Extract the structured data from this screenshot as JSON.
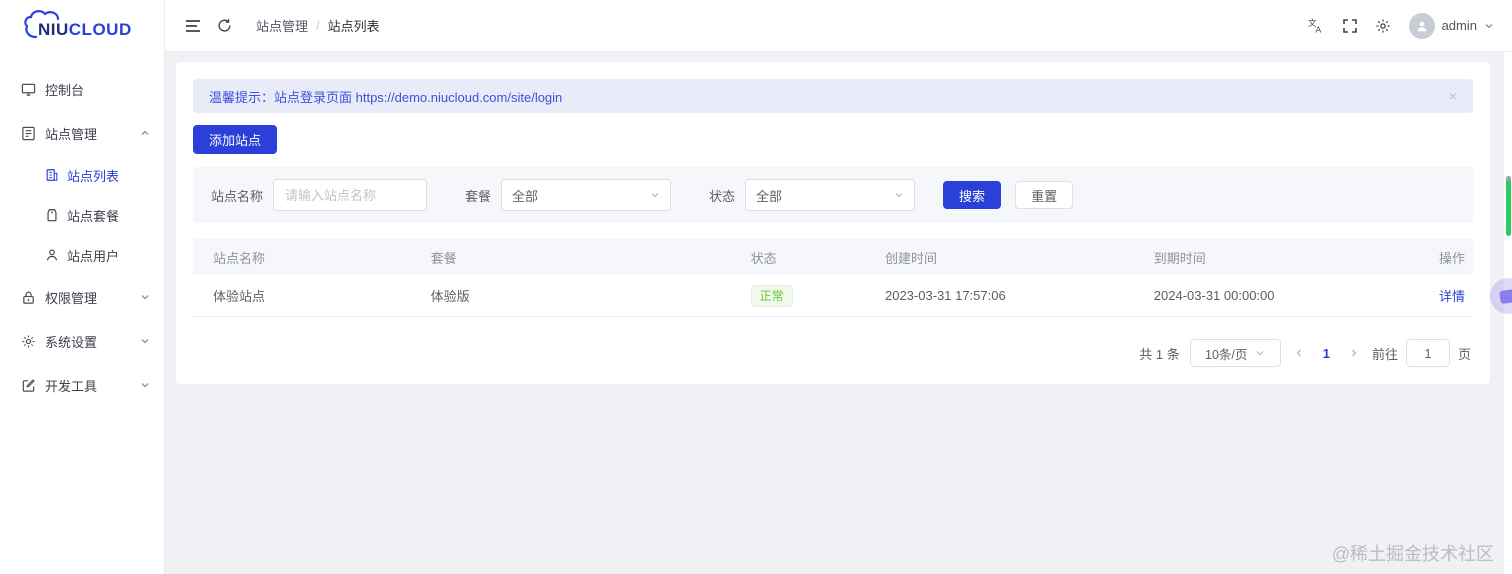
{
  "brand": {
    "niu": "NIU",
    "cloud": "CLOUD"
  },
  "sidebar": {
    "items": [
      {
        "label": "控制台",
        "icon": "monitor-icon"
      },
      {
        "label": "站点管理",
        "icon": "board-icon",
        "expanded": true,
        "children": [
          {
            "label": "站点列表",
            "icon": "building-icon",
            "active": true
          },
          {
            "label": "站点套餐",
            "icon": "tag-icon"
          },
          {
            "label": "站点用户",
            "icon": "user-icon"
          }
        ]
      },
      {
        "label": "权限管理",
        "icon": "lock-icon"
      },
      {
        "label": "系统设置",
        "icon": "gear-icon"
      },
      {
        "label": "开发工具",
        "icon": "edit-icon"
      }
    ]
  },
  "topbar": {
    "breadcrumb": {
      "first": "站点管理",
      "sep": "/",
      "last": "站点列表"
    },
    "username": "admin"
  },
  "alert": {
    "text": "温馨提示：站点登录页面 https://demo.niucloud.com/site/login",
    "close": "×"
  },
  "actions": {
    "add_site": "添加站点",
    "search": "搜索",
    "reset": "重置"
  },
  "filters": {
    "site_name_label": "站点名称",
    "site_name_placeholder": "请输入站点名称",
    "package_label": "套餐",
    "package_value": "全部",
    "status_label": "状态",
    "status_value": "全部"
  },
  "table": {
    "headers": [
      "站点名称",
      "套餐",
      "状态",
      "创建时间",
      "到期时间",
      "操作"
    ],
    "rows": [
      {
        "name": "体验站点",
        "package": "体验版",
        "status": "正常",
        "created": "2023-03-31 17:57:06",
        "expires": "2024-03-31 00:00:00",
        "action": "详情"
      }
    ]
  },
  "pagination": {
    "total": "共 1 条",
    "page_size": "10条/页",
    "current": "1",
    "goto_label": "前往",
    "goto_value": "1",
    "page_label": "页"
  },
  "watermark": "@稀土掘金技术社区",
  "colors": {
    "primary": "#2b40d9",
    "success": "#67c23a",
    "alert_bg": "#e9ebf9"
  }
}
